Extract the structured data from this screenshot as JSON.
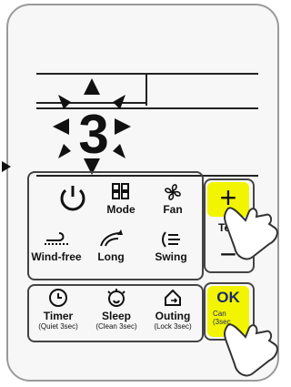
{
  "display": {
    "digit": "3"
  },
  "buttons": {
    "mode": "Mode",
    "fan": "Fan",
    "wind_free": "Wind-free",
    "long": "Long",
    "swing": "Swing",
    "timer": "Timer",
    "timer_sub": "(Quiet 3sec)",
    "sleep": "Sleep",
    "sleep_sub": "(Clean 3sec)",
    "outing": "Outing",
    "outing_sub": "(Lock 3sec)",
    "temp_label": "Tem",
    "plus": "+",
    "minus": "−",
    "ok": "OK",
    "ok_sub1": "Can",
    "ok_sub2": "(3sec"
  },
  "colors": {
    "highlight": "#f3f400",
    "outline": "#444444"
  }
}
